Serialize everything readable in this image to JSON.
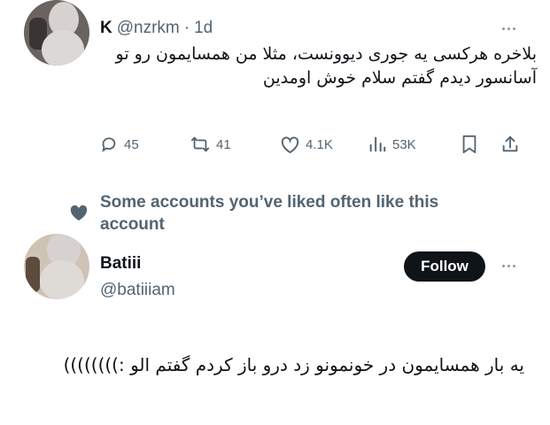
{
  "tweet": {
    "author_name": "K",
    "author_handle": "@nzrkm",
    "separator": "·",
    "time": "1d",
    "text": "بلاخره هرکسی یه جوری دیوونست، مثلا من همسایمون رو تو آسانسور دیدم گفتم سلام خوش اومدین",
    "stats": {
      "replies": "45",
      "reposts": "41",
      "likes": "4.1K",
      "views": "53K"
    }
  },
  "recommendation": {
    "text": "Some accounts you’ve liked often like this account"
  },
  "suggested_user": {
    "name": "Batiii",
    "handle": "@batiiiam",
    "follow_label": "Follow",
    "bio": "یه بار همسایمون در خونمونو زد درو باز کردم گفتم الو :))))))))"
  },
  "icons": {
    "reply": "reply-icon",
    "repost": "repost-icon",
    "like": "heart-icon",
    "views": "views-icon",
    "bookmark": "bookmark-icon",
    "share": "share-icon",
    "more": "more-icon",
    "rec": "heart-filled-icon"
  },
  "colors": {
    "text": "#0f1419",
    "secondary": "#536471",
    "follow_bg": "#0f1419",
    "follow_fg": "#ffffff"
  }
}
